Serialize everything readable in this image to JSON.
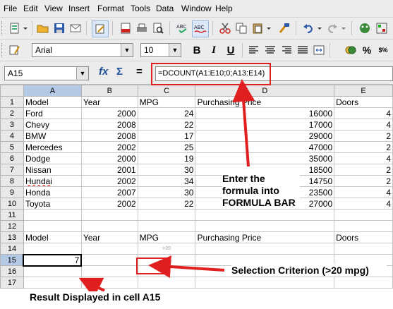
{
  "menu": [
    "File",
    "Edit",
    "View",
    "Insert",
    "Format",
    "Tools",
    "Data",
    "Window",
    "Help"
  ],
  "toolbar": {
    "font_name": "Arial",
    "font_size": "10"
  },
  "formula_bar": {
    "cell_ref": "A15",
    "function_icon": "fx",
    "sum_icon": "Σ",
    "equals_icon": "=",
    "formula": "=DCOUNT(A1:E10;0;A13:E14)"
  },
  "columns": [
    "A",
    "B",
    "C",
    "D",
    "E"
  ],
  "rows": [
    {
      "n": "1",
      "a": "Model",
      "b": "Year",
      "c": "MPG",
      "d": "Purchasing Price",
      "e": "Doors"
    },
    {
      "n": "2",
      "a": "Ford",
      "b": "2000",
      "c": "24",
      "d": "16000",
      "e": "4"
    },
    {
      "n": "3",
      "a": "Chevy",
      "b": "2008",
      "c": "22",
      "d": "17000",
      "e": "4"
    },
    {
      "n": "4",
      "a": "BMW",
      "b": "2008",
      "c": "17",
      "d": "29000",
      "e": "2"
    },
    {
      "n": "5",
      "a": "Mercedes",
      "b": "2002",
      "c": "25",
      "d": "47000",
      "e": "2"
    },
    {
      "n": "6",
      "a": "Dodge",
      "b": "2000",
      "c": "19",
      "d": "35000",
      "e": "4"
    },
    {
      "n": "7",
      "a": "Nissan",
      "b": "2001",
      "c": "30",
      "d": "18500",
      "e": "2"
    },
    {
      "n": "8",
      "a": "Hundai",
      "b": "2002",
      "c": "34",
      "d": "14750",
      "e": "2"
    },
    {
      "n": "9",
      "a": "Honda",
      "b": "2007",
      "c": "30",
      "d": "23500",
      "e": "4"
    },
    {
      "n": "10",
      "a": "Toyota",
      "b": "2002",
      "c": "22",
      "d": "27000",
      "e": "4"
    },
    {
      "n": "11",
      "a": "",
      "b": "",
      "c": "",
      "d": "",
      "e": ""
    },
    {
      "n": "12",
      "a": "",
      "b": "",
      "c": "",
      "d": "",
      "e": ""
    },
    {
      "n": "13",
      "a": "Model",
      "b": "Year",
      "c": "MPG",
      "d": "Purchasing Price",
      "e": "Doors"
    },
    {
      "n": "14",
      "a": "",
      "b": "",
      "c": ">20",
      "d": "",
      "e": ""
    },
    {
      "n": "15",
      "a": "7",
      "b": "",
      "c": "",
      "d": "",
      "e": ""
    },
    {
      "n": "16",
      "a": "",
      "b": "",
      "c": "",
      "d": "",
      "e": ""
    },
    {
      "n": "17",
      "a": "",
      "b": "",
      "c": "",
      "d": "",
      "e": ""
    }
  ],
  "annotations": {
    "formula_note": "Enter the formula into FORMULA BAR",
    "criterion_note": "Selection Criterion (>20 mpg)",
    "result_note": "Result Displayed in cell A15"
  },
  "colors": {
    "annotation_red": "#e02020",
    "selected_header": "#b4c9e6"
  }
}
